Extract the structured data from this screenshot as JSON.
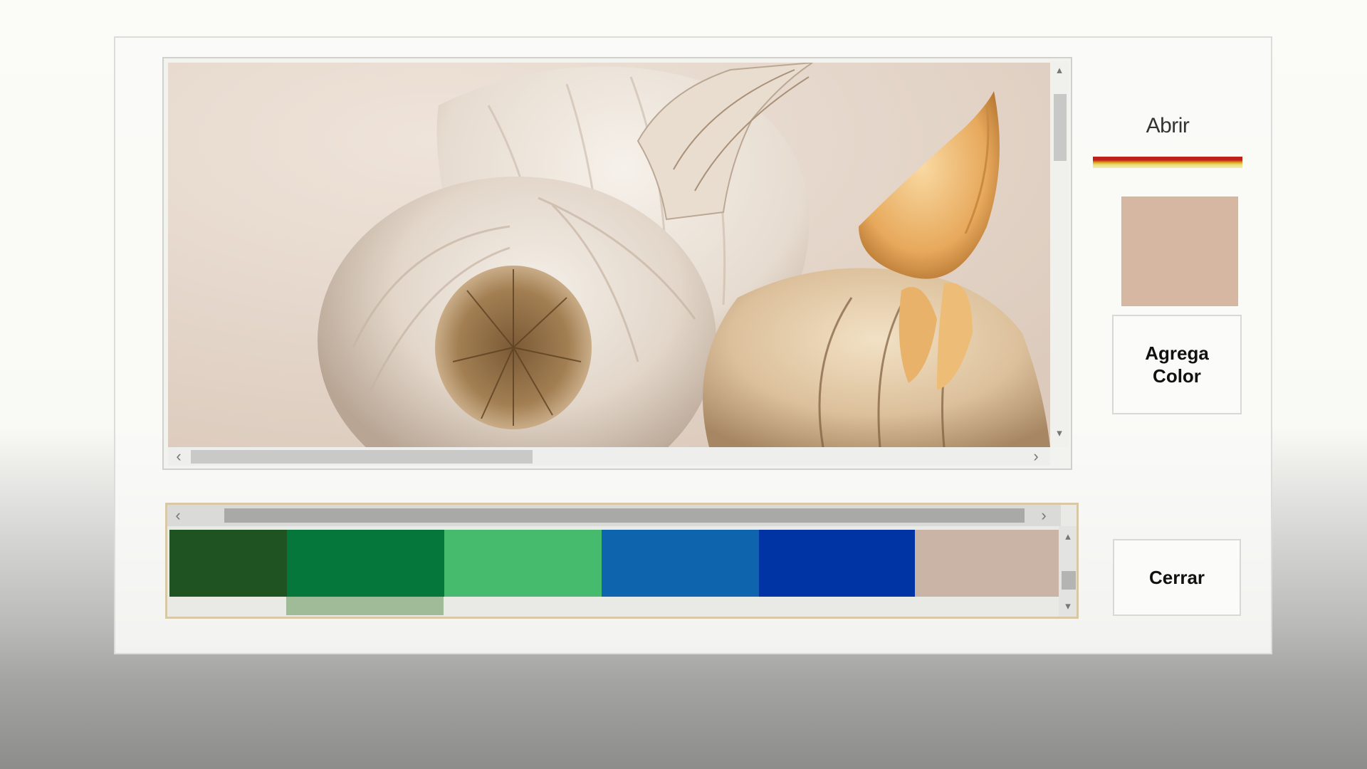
{
  "window": {
    "image": {
      "subject": "garlic bulbs and cloves photo",
      "background_color": "#e7d9ce"
    },
    "open_button": {
      "label": "Abrir",
      "icon": "open-color-underline"
    },
    "selected_color": "#d6b7a2",
    "add_color_button": {
      "label": "Agrega Color"
    },
    "close_button": {
      "label": "Cerrar"
    },
    "palette": {
      "swatches": [
        {
          "color": "#1f5422"
        },
        {
          "color": "#06773a"
        },
        {
          "color": "#47bb6d"
        },
        {
          "color": "#0e65ad"
        },
        {
          "color": "#0033a3"
        },
        {
          "color": "#c9b4a5"
        }
      ]
    },
    "scroll_icons": {
      "up": "▴",
      "down": "▾",
      "left": "‹",
      "right": "›"
    }
  }
}
